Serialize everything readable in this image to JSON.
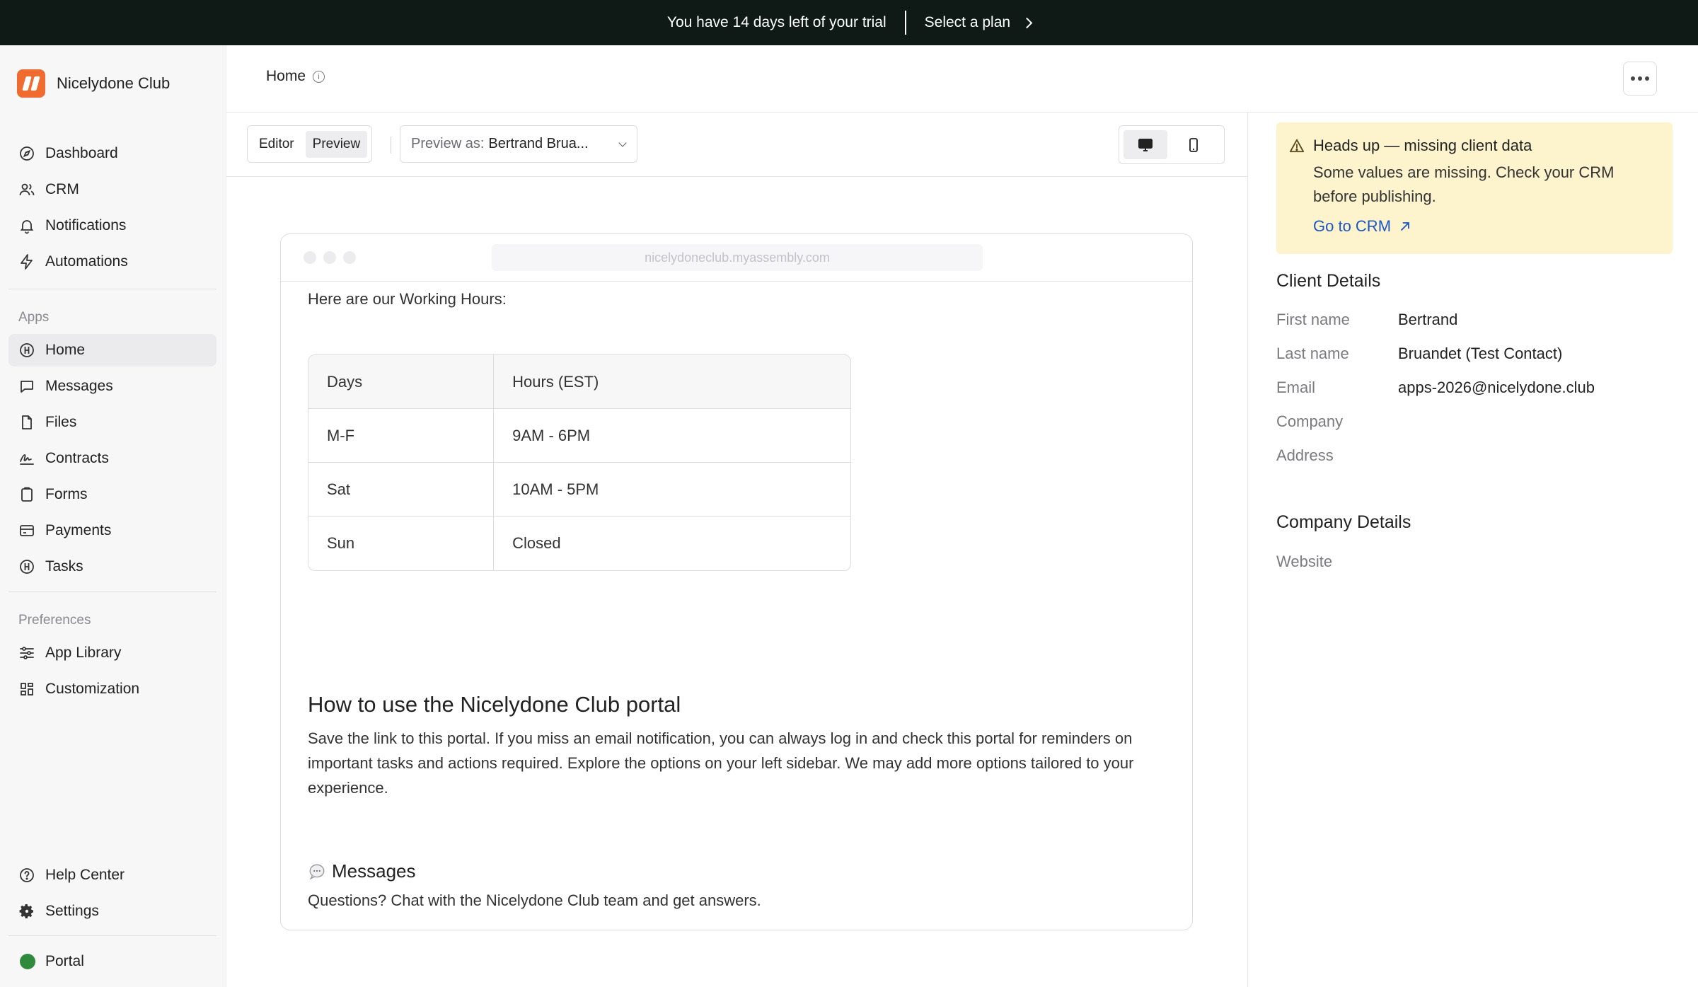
{
  "banner": {
    "trial_text": "You have 14 days left of your trial",
    "plan_label": "Select a plan"
  },
  "workspace": {
    "name": "Nicelydone Club"
  },
  "sidebar": {
    "main": [
      {
        "label": "Dashboard",
        "icon": "compass-icon"
      },
      {
        "label": "CRM",
        "icon": "users-icon"
      },
      {
        "label": "Notifications",
        "icon": "bell-icon"
      },
      {
        "label": "Automations",
        "icon": "bolt-icon"
      }
    ],
    "apps_label": "Apps",
    "apps": [
      {
        "label": "Home",
        "icon": "home-icon",
        "active": true
      },
      {
        "label": "Messages",
        "icon": "message-icon"
      },
      {
        "label": "Files",
        "icon": "file-icon"
      },
      {
        "label": "Contracts",
        "icon": "signature-icon"
      },
      {
        "label": "Forms",
        "icon": "clipboard-icon"
      },
      {
        "label": "Payments",
        "icon": "card-icon"
      },
      {
        "label": "Tasks",
        "icon": "tasks-icon"
      }
    ],
    "preferences_label": "Preferences",
    "preferences": [
      {
        "label": "App Library",
        "icon": "sliders-icon"
      },
      {
        "label": "Customization",
        "icon": "grid-icon"
      }
    ],
    "bottom": [
      {
        "label": "Help Center",
        "icon": "help-icon"
      },
      {
        "label": "Settings",
        "icon": "gear-icon"
      }
    ],
    "portal_label": "Portal",
    "portal_color": "#2f8a3e"
  },
  "header": {
    "title": "Home"
  },
  "toolbar": {
    "editor_label": "Editor",
    "preview_label": "Preview",
    "preview_as_label": "Preview as:",
    "preview_as_value": "Bertrand Brua..."
  },
  "preview": {
    "url": "nicelydoneclub.myassembly.com",
    "intro": "Here are our Working Hours:",
    "table": {
      "headers": [
        "Days",
        "Hours (EST)"
      ],
      "rows": [
        [
          "M-F",
          "9AM - 6PM"
        ],
        [
          "Sat",
          "10AM - 5PM"
        ],
        [
          "Sun",
          "Closed"
        ]
      ]
    },
    "heading": "How to use the Nicelydone Club portal",
    "paragraph": "Save the link to this portal. If you miss an email notification, you can always log in and check this portal for reminders on important tasks and actions required. Explore the options on your left sidebar. We may add more options tailored to your experience.",
    "messages_heading": "Messages",
    "messages_text": "Questions? Chat with the Nicelydone Club team and get answers."
  },
  "alert": {
    "title": "Heads up — missing client data",
    "body": "Some values are missing. Check your CRM before publishing.",
    "link": "Go to CRM"
  },
  "client_details": {
    "title": "Client Details",
    "fields": [
      {
        "label": "First name",
        "value": "Bertrand"
      },
      {
        "label": "Last name",
        "value": "Bruandet (Test Contact)"
      },
      {
        "label": "Email",
        "value": "apps-2026@nicelydone.club"
      },
      {
        "label": "Company",
        "value": ""
      },
      {
        "label": "Address",
        "value": ""
      }
    ]
  },
  "company_details": {
    "title": "Company Details",
    "fields": [
      {
        "label": "Website",
        "value": ""
      }
    ]
  }
}
